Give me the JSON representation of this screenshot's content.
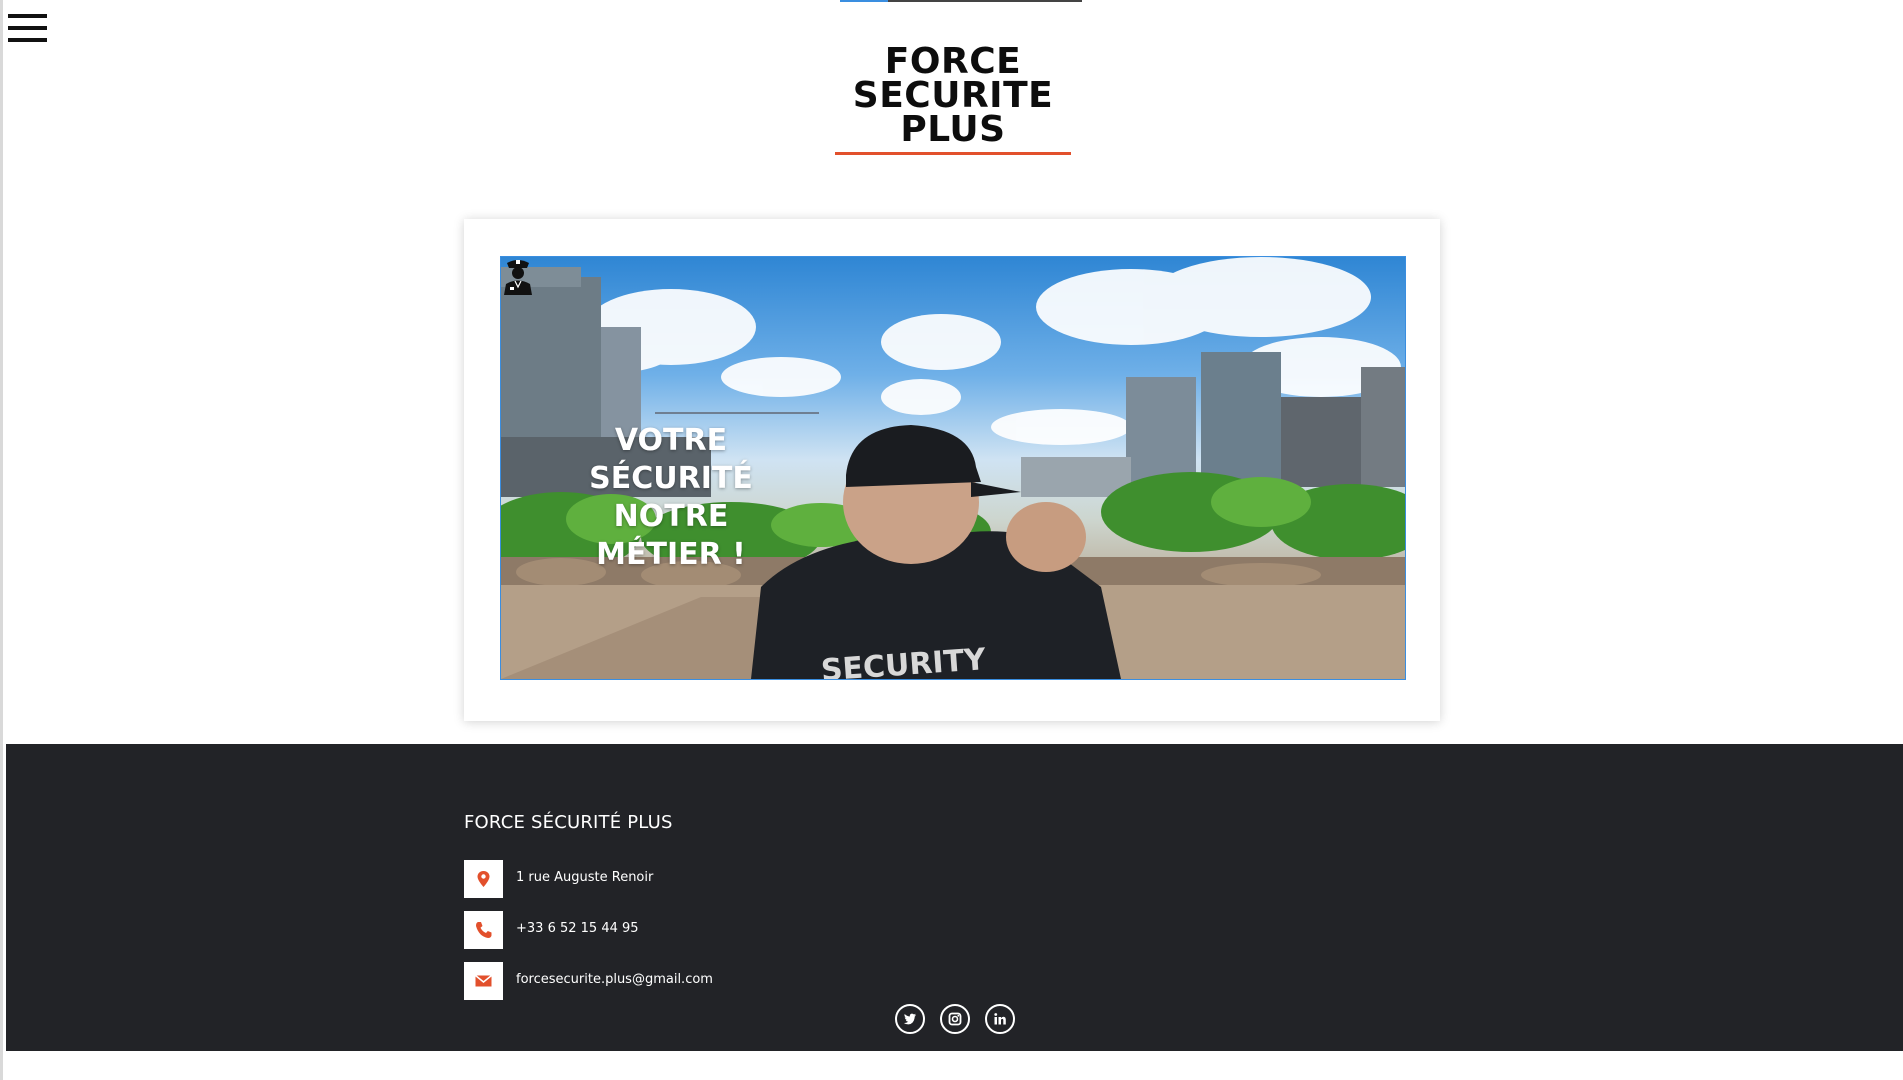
{
  "logo": {
    "line1": "FORCE",
    "line2": "SECURITE",
    "line3": "PLUS"
  },
  "hero": {
    "title_line1": "VOTRE",
    "title_line2": "SÉCURITÉ NOTRE",
    "title_line3": "MÉTIER !"
  },
  "footer": {
    "title": "FORCE SÉCURITÉ PLUS",
    "contacts": [
      {
        "icon": "map-pin-icon",
        "text": "1 rue Auguste Renoir"
      },
      {
        "icon": "phone-icon",
        "text": "+33 6 52 15 44 95"
      },
      {
        "icon": "envelope-icon",
        "text": "forcesecurite.plus@gmail.com"
      }
    ],
    "social": [
      {
        "icon": "twitter-icon"
      },
      {
        "icon": "instagram-icon"
      },
      {
        "icon": "linkedin-icon"
      }
    ]
  },
  "colors": {
    "accent": "#e2502c",
    "footer_bg": "#222327",
    "progress": "#3a8ee0"
  },
  "scroll_progress": 0.2
}
